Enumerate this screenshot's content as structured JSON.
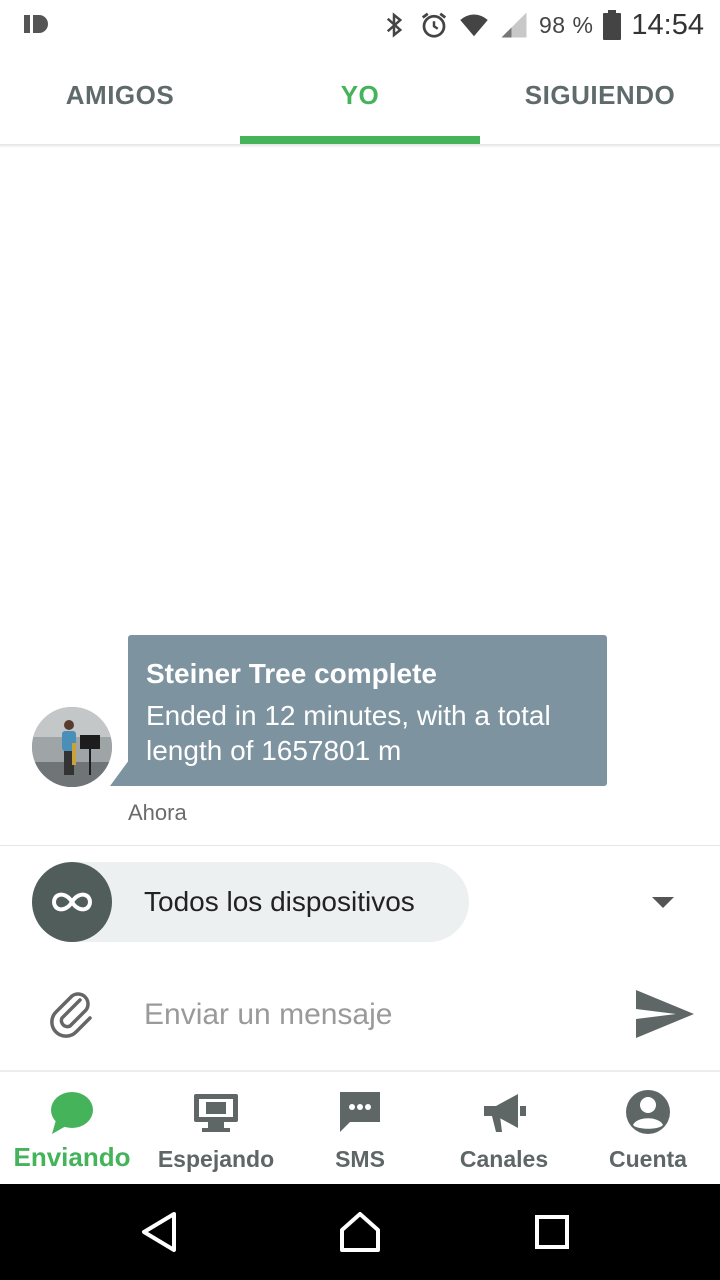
{
  "status_bar": {
    "battery_text": "98 %",
    "time": "14:54",
    "icons": [
      "app-notification-icon",
      "bluetooth-icon",
      "alarm-icon",
      "wifi-icon",
      "cell-signal-icon",
      "battery-icon"
    ]
  },
  "tabs": [
    {
      "label": "AMIGOS",
      "active": false
    },
    {
      "label": "YO",
      "active": true
    },
    {
      "label": "SIGUIENDO",
      "active": false
    }
  ],
  "message": {
    "title": "Steiner Tree complete",
    "body": "Ended in 12 minutes, with a total length of 1657801 m",
    "time": "Ahora"
  },
  "device_selector": {
    "label": "Todos los dispositivos",
    "icon": "infinity-icon"
  },
  "composer": {
    "placeholder": "Enviar un mensaje",
    "value": ""
  },
  "bottom_nav": [
    {
      "label": "Enviando",
      "icon": "chat-bubble-icon",
      "active": true
    },
    {
      "label": "Espejando",
      "icon": "monitor-icon",
      "active": false
    },
    {
      "label": "SMS",
      "icon": "sms-icon",
      "active": false
    },
    {
      "label": "Canales",
      "icon": "megaphone-icon",
      "active": false
    },
    {
      "label": "Cuenta",
      "icon": "account-icon",
      "active": false
    }
  ],
  "colors": {
    "accent": "#44b35a",
    "bubble": "#7d939f",
    "icon_gray": "#515d5b",
    "pill_bg": "#edf0f1"
  }
}
